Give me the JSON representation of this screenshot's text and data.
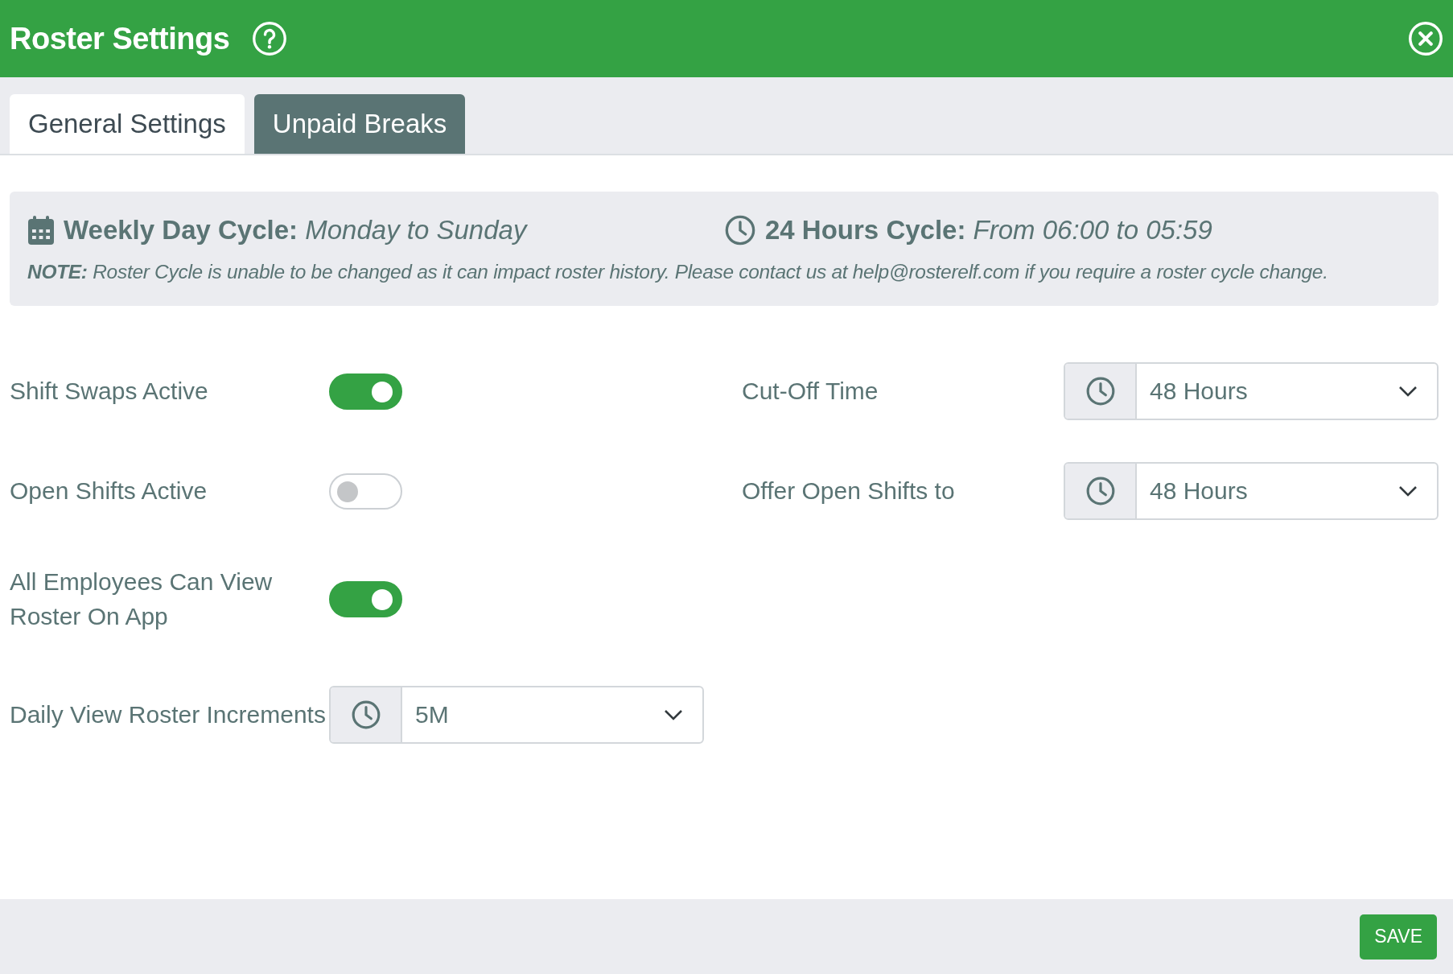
{
  "header": {
    "title": "Roster Settings"
  },
  "tabs": [
    {
      "label": "General Settings",
      "selected": true
    },
    {
      "label": "Unpaid Breaks",
      "selected": false
    }
  ],
  "info": {
    "cycles": [
      {
        "kind": "calendar",
        "text": "**Weekly Day Cycle:** *Monday to Sunday*"
      },
      {
        "kind": "clock",
        "text": "**24 Hours Cycle:** *From 06:00 to 05:59*"
      }
    ],
    "note": "**NOTE:** Roster Cycle is unable to be changed as it can impact roster history. Please contact us at help@rosterelf.com if you require a roster cycle change."
  },
  "rows": [
    {
      "left": {
        "label": "Shift Swaps Active",
        "kind": "toggle",
        "on": true
      },
      "right": {
        "label": "Cut-Off Time",
        "kind": "select",
        "value": "48 Hours"
      }
    },
    {
      "left": {
        "label": "Open Shifts Active",
        "kind": "toggle",
        "on": false
      },
      "right": {
        "label": "Offer Open Shifts to",
        "kind": "select",
        "value": "48 Hours"
      }
    },
    {
      "left": {
        "label": "All Employees Can View Roster On App",
        "kind": "toggle",
        "on": true
      }
    },
    {
      "left": {
        "label": "Daily View Roster Increments",
        "kind": "select",
        "value": "5M"
      }
    }
  ],
  "footer": {
    "save": "SAVE"
  }
}
